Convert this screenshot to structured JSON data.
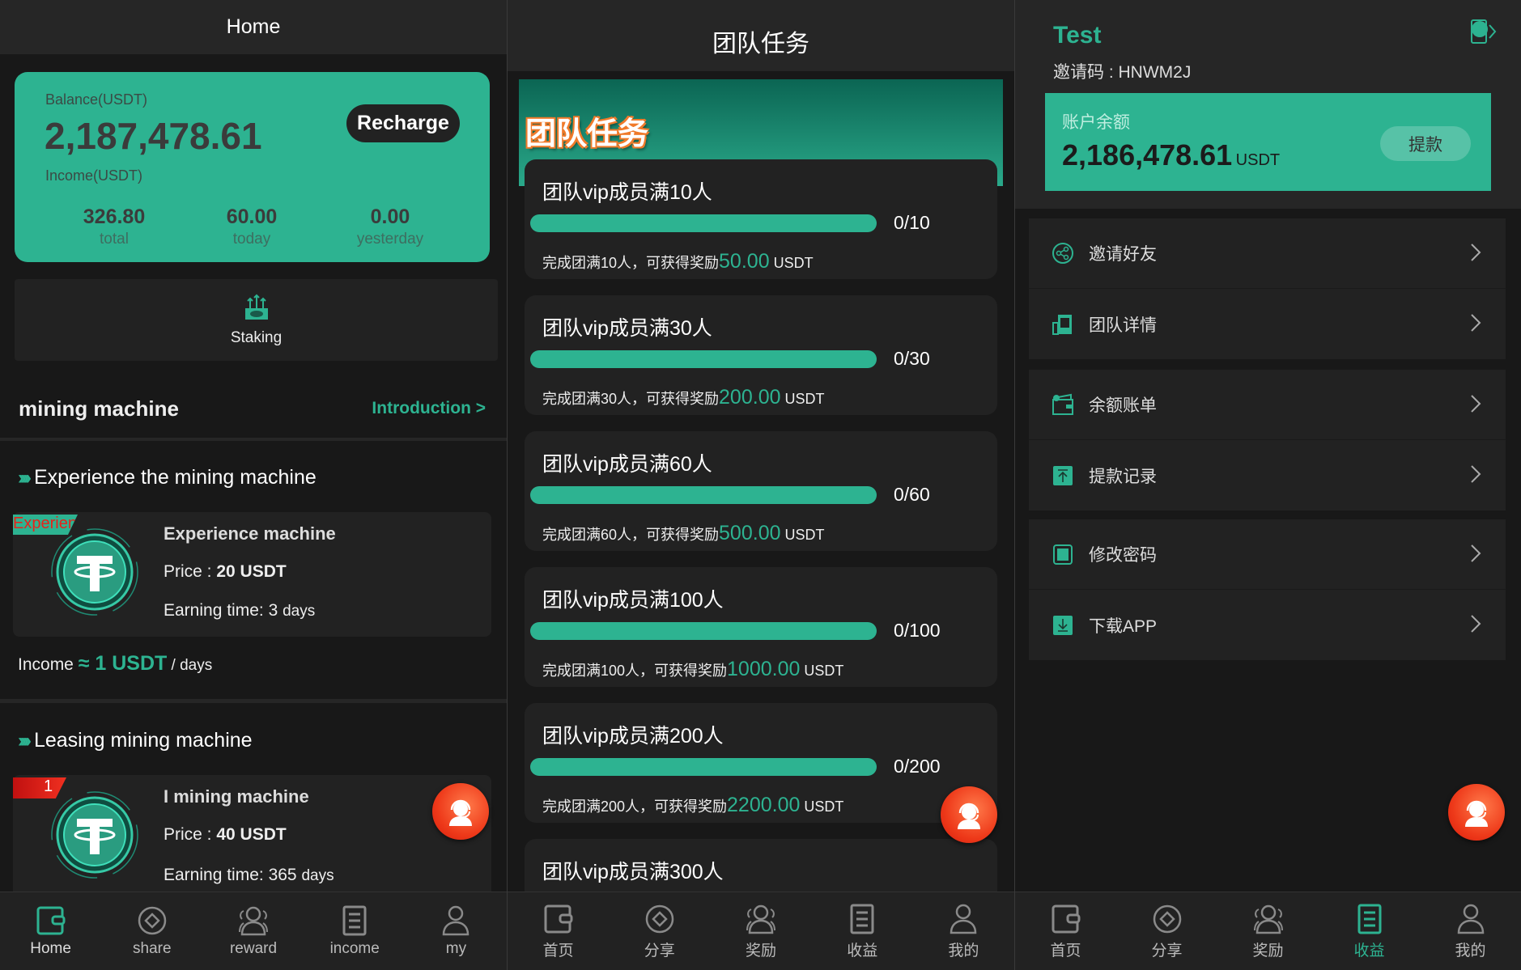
{
  "colors": {
    "accent": "#2db391",
    "background": "#181818",
    "card": "#222222",
    "support": "#ee3a1a"
  },
  "home": {
    "title": "Home",
    "balance_label": "Balance(USDT)",
    "balance": "2,187,478.61",
    "recharge": "Recharge",
    "income_label": "Income(USDT)",
    "stats": [
      {
        "value": "326.80",
        "label": "total"
      },
      {
        "value": "60.00",
        "label": "today"
      },
      {
        "value": "0.00",
        "label": "yesterday"
      }
    ],
    "staking": "Staking",
    "section_title": "mining machine",
    "introduction": "Introduction >",
    "experience_title": "Experience the mining machine",
    "experience_card": {
      "badge": "Experience",
      "name": "Experience machine",
      "price_label": "Price : ",
      "price": "20 USDT",
      "time_label": "Earning time: ",
      "time": "3",
      "time_unit": "days"
    },
    "income_line": {
      "label": "Income ",
      "approx": "≈ 1 USDT",
      "unit": " / days"
    },
    "leasing_title": "Leasing mining machine",
    "leasing_card": {
      "badge": "1",
      "name": "I  mining machine",
      "price_label": "Price : ",
      "price": "40 USDT",
      "time_label": "Earning time: ",
      "time": "365",
      "time_unit": "days"
    },
    "nav": [
      {
        "label": "Home",
        "icon": "wallet",
        "active": true
      },
      {
        "label": "share",
        "icon": "share"
      },
      {
        "label": "reward",
        "icon": "people"
      },
      {
        "label": "income",
        "icon": "document"
      },
      {
        "label": "my",
        "icon": "person"
      }
    ]
  },
  "tasks": {
    "title": "团队任务",
    "banner_title": "团队任务",
    "items": [
      {
        "title": "团队vip成员满10人",
        "progress": "0/10",
        "done": 0,
        "target": 10,
        "desc": "完成团满10人，可获得奖励",
        "reward": "50.00",
        "unit": "USDT"
      },
      {
        "title": "团队vip成员满30人",
        "progress": "0/30",
        "done": 0,
        "target": 30,
        "desc": "完成团满30人，可获得奖励",
        "reward": "200.00",
        "unit": "USDT"
      },
      {
        "title": "团队vip成员满60人",
        "progress": "0/60",
        "done": 0,
        "target": 60,
        "desc": "完成团满60人，可获得奖励",
        "reward": "500.00",
        "unit": "USDT"
      },
      {
        "title": "团队vip成员满100人",
        "progress": "0/100",
        "done": 0,
        "target": 100,
        "desc": "完成团满100人，可获得奖励",
        "reward": "1000.00",
        "unit": "USDT"
      },
      {
        "title": "团队vip成员满200人",
        "progress": "0/200",
        "done": 0,
        "target": 200,
        "desc": "完成团满200人，可获得奖励",
        "reward": "2200.00",
        "unit": "USDT"
      },
      {
        "title": "团队vip成员满300人"
      }
    ],
    "nav": [
      {
        "label": "首页",
        "icon": "wallet"
      },
      {
        "label": "分享",
        "icon": "share"
      },
      {
        "label": "奖励",
        "icon": "people"
      },
      {
        "label": "收益",
        "icon": "document"
      },
      {
        "label": "我的",
        "icon": "person"
      }
    ]
  },
  "profile": {
    "username": "Test",
    "invite_label": "邀请码 : ",
    "invite_code": "HNWM2J",
    "balance_label": "账户余额",
    "balance": "2,186,478.61",
    "unit": "USDT",
    "withdraw": "提款",
    "groups": [
      [
        {
          "label": "邀请好友",
          "icon": "share-nodes"
        },
        {
          "label": "团队详情",
          "icon": "team"
        }
      ],
      [
        {
          "label": "余额账单",
          "icon": "wallet-bill"
        },
        {
          "label": "提款记录",
          "icon": "upload"
        }
      ],
      [
        {
          "label": "修改密码",
          "icon": "lock"
        },
        {
          "label": "下载APP",
          "icon": "download"
        }
      ]
    ],
    "nav": [
      {
        "label": "首页",
        "icon": "wallet"
      },
      {
        "label": "分享",
        "icon": "share"
      },
      {
        "label": "奖励",
        "icon": "people"
      },
      {
        "label": "收益",
        "icon": "document",
        "active": true
      },
      {
        "label": "我的",
        "icon": "person"
      }
    ]
  }
}
